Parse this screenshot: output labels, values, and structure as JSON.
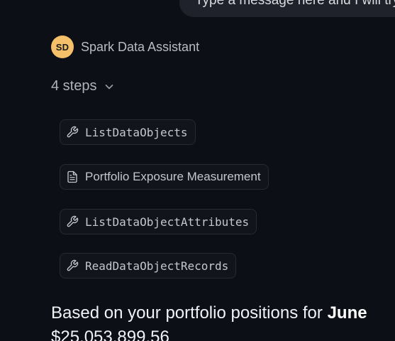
{
  "user_message": {
    "text": "Type a message here and I will try my best to analyze it"
  },
  "assistant": {
    "avatar_initials": "SD",
    "name": "Spark Data Assistant",
    "avatar_color": "#f4c06a"
  },
  "steps": {
    "toggle_label": "4 steps",
    "items": [
      {
        "label": "ListDataObjects",
        "icon": "wrench-icon"
      },
      {
        "label": "Portfolio Exposure Measurement",
        "icon": "document-icon"
      },
      {
        "label": "ListDataObjectAttributes",
        "icon": "wrench-icon"
      },
      {
        "label": "ReadDataObjectRecords",
        "icon": "wrench-icon"
      }
    ]
  },
  "answer": {
    "line1_prefix": "Based on your portfolio positions for ",
    "line1_bold": "June",
    "line2": "$25,053,899.56"
  }
}
